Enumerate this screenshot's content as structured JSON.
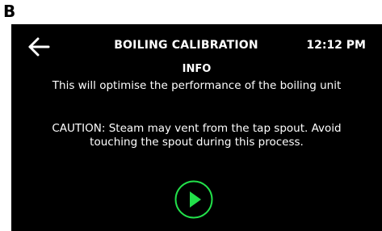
{
  "panel_label": "B",
  "header": {
    "back_icon": "arrow-left-icon",
    "title": "BOILING CALIBRATION",
    "time": "12:12 PM"
  },
  "content": {
    "heading": "INFO",
    "description": "This will optimise the performance of the boiling unit",
    "caution": "CAUTION: Steam may vent from the tap spout. Avoid touching the spout during this process."
  },
  "actions": {
    "start_icon": "play-icon"
  },
  "colors": {
    "background": "#000000",
    "text": "#ffffff",
    "accent": "#22e04a"
  }
}
